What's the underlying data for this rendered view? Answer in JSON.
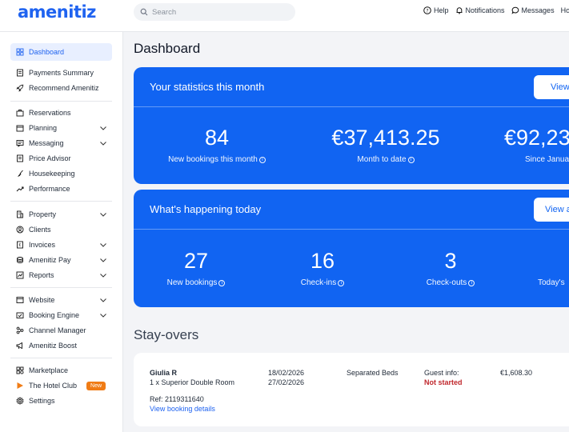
{
  "brand": {
    "logo": "amenitiz"
  },
  "search": {
    "placeholder": "Search"
  },
  "topbar": {
    "help": "Help",
    "notifications": "Notifications",
    "messages": "Messages",
    "hotel": "Hote"
  },
  "sidebar": {
    "items": [
      {
        "label": "Dashboard",
        "icon": "grid-icon",
        "active": true
      },
      {
        "label": "Payments Summary",
        "icon": "receipt-icon"
      },
      {
        "label": "Recommend Amenitiz",
        "icon": "rocket-icon"
      },
      {
        "label": "Reservations",
        "icon": "suitcase-icon"
      },
      {
        "label": "Planning",
        "icon": "calendar-icon",
        "expandable": true
      },
      {
        "label": "Messaging",
        "icon": "message-icon",
        "expandable": true
      },
      {
        "label": "Price Advisor",
        "icon": "document-icon"
      },
      {
        "label": "Housekeeping",
        "icon": "broom-icon"
      },
      {
        "label": "Performance",
        "icon": "trend-icon"
      },
      {
        "label": "Property",
        "icon": "building-icon",
        "expandable": true
      },
      {
        "label": "Clients",
        "icon": "users-icon"
      },
      {
        "label": "Invoices",
        "icon": "invoice-icon",
        "expandable": true
      },
      {
        "label": "Amenitiz Pay",
        "icon": "coins-icon",
        "expandable": true
      },
      {
        "label": "Reports",
        "icon": "chart-icon",
        "expandable": true
      },
      {
        "label": "Website",
        "icon": "browser-icon",
        "expandable": true
      },
      {
        "label": "Booking Engine",
        "icon": "engine-icon",
        "expandable": true
      },
      {
        "label": "Channel Manager",
        "icon": "channels-icon"
      },
      {
        "label": "Amenitiz Boost",
        "icon": "megaphone-icon"
      },
      {
        "label": "Marketplace",
        "icon": "apps-icon"
      },
      {
        "label": "The Hotel Club",
        "icon": "play-icon",
        "badge": "New"
      },
      {
        "label": "Settings",
        "icon": "gear-icon"
      }
    ]
  },
  "main": {
    "title": "Dashboard",
    "statistics": {
      "title": "Your statistics this month",
      "button": "View",
      "stats": [
        {
          "value": "84",
          "label": "New bookings this month"
        },
        {
          "value": "€37,413.25",
          "label": "Month to date"
        },
        {
          "value": "€92,23",
          "label": "Since Janua"
        }
      ]
    },
    "today": {
      "title": "What's happening today",
      "button": "View a",
      "stats": [
        {
          "value": "27",
          "label": "New bookings"
        },
        {
          "value": "16",
          "label": "Check-ins"
        },
        {
          "value": "3",
          "label": "Check-outs"
        },
        {
          "value": "",
          "label": "Today's"
        }
      ]
    },
    "stayovers": {
      "title": "Stay-overs",
      "booking": {
        "guest": "Giulia R",
        "room": "1 x Superior Double Room",
        "ref": "Ref: 2119311640",
        "link": "View booking details",
        "check_in": "18/02/2026",
        "check_out": "27/02/2026",
        "beds": "Separated Beds",
        "guest_info_label": "Guest info:",
        "guest_info_status": "Not started",
        "amount": "€1,608.30"
      }
    }
  },
  "colors": {
    "accent": "#1164f2",
    "brand": "#1f63f0",
    "badge": "#f07c16",
    "danger": "#c0282d"
  }
}
